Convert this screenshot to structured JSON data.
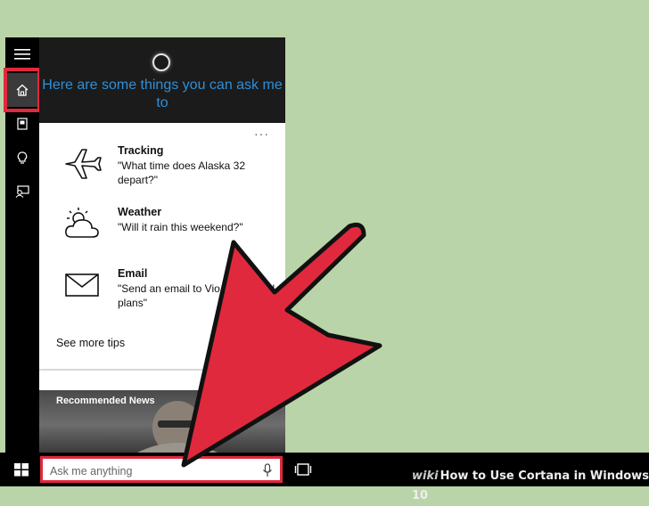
{
  "cortana": {
    "header": "Here are some things you can ask me to",
    "more_label": "···",
    "tips": [
      {
        "title": "Tracking",
        "text": "\"What time does Alaska 32 depart?\"",
        "icon": "airplane-icon"
      },
      {
        "title": "Weather",
        "text": "\"Will it rain this weekend?\"",
        "icon": "weather-cloud-icon"
      },
      {
        "title": "Email",
        "text": "\"Send an email to Vio... weekend plans\"",
        "icon": "mail-icon"
      }
    ],
    "see_more": "See more tips",
    "news_title": "Recommended News",
    "rail_icons": [
      "hamburger-icon",
      "home-icon",
      "notebook-icon",
      "lightbulb-icon",
      "feedback-icon"
    ]
  },
  "taskbar": {
    "search_placeholder": "Ask me anything",
    "start_icon": "windows-logo-icon",
    "mic_icon": "microphone-icon",
    "task_view_icon": "task-view-icon"
  },
  "watermark": {
    "brand": "wiki",
    "title": "How to Use Cortana in Windows 10"
  },
  "colors": {
    "background": "#b9d4a8",
    "accent": "#2f8fd8",
    "highlight": "#e0293d"
  }
}
